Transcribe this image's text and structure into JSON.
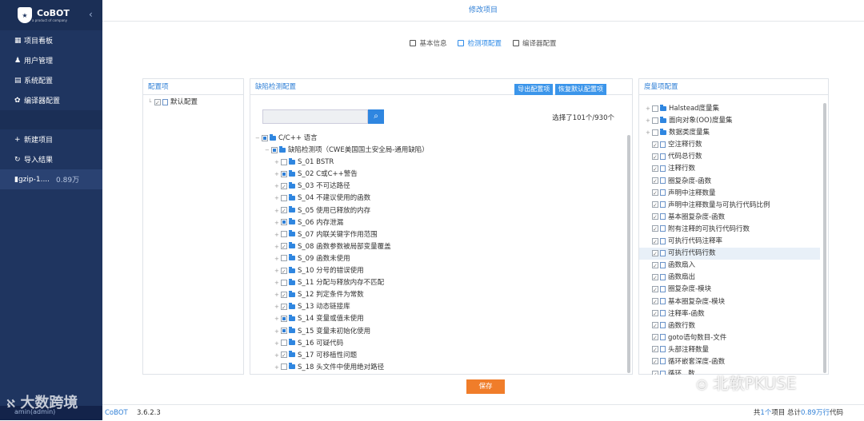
{
  "app": {
    "logo_text": "CoBOT",
    "logo_sub": "a product of company",
    "collapse": "‹"
  },
  "sidebar": {
    "nav": [
      {
        "label": "项目看板",
        "icon": "grid-icon"
      },
      {
        "label": "用户管理",
        "icon": "user-icon"
      },
      {
        "label": "系统配置",
        "icon": "document-icon"
      },
      {
        "label": "编译器配置",
        "icon": "gear-icon"
      }
    ],
    "actions": [
      {
        "label": "新建项目",
        "icon": "plus-icon"
      },
      {
        "label": "导入结果",
        "icon": "refresh-icon"
      }
    ],
    "project": {
      "name": "gzip-1....",
      "size": "0.89万"
    }
  },
  "header": {
    "title": "修改项目"
  },
  "tabs": [
    {
      "label": "基本信息",
      "active": false
    },
    {
      "label": "检测项配置",
      "active": true
    },
    {
      "label": "编译器配置",
      "active": false
    }
  ],
  "config_panel": {
    "title": "配置项",
    "root": "默认配置"
  },
  "defect_panel": {
    "title": "缺陷检测配置",
    "export_label": "导出配置项",
    "restore_label": "恢复默认配置项",
    "selected_text": "选择了101个/930个",
    "tree": [
      {
        "label": "C/C++ 语言",
        "level": 0,
        "state": "partial",
        "tog": "−"
      },
      {
        "label": "缺陷检测项（CWE美国国土安全局-通用缺陷）",
        "level": 1,
        "state": "partial",
        "tog": "−"
      },
      {
        "label": "S_01 BSTR",
        "level": 2,
        "state": "none",
        "tog": "+"
      },
      {
        "label": "S_02 C或C++警告",
        "level": 2,
        "state": "partial",
        "tog": "+"
      },
      {
        "label": "S_03 不可达路径",
        "level": 2,
        "state": "checked",
        "tog": "+"
      },
      {
        "label": "S_04 不建议使用的函数",
        "level": 2,
        "state": "none",
        "tog": "+"
      },
      {
        "label": "S_05 使用已释放的内存",
        "level": 2,
        "state": "checked",
        "tog": "+"
      },
      {
        "label": "S_06 内存泄漏",
        "level": 2,
        "state": "partial",
        "tog": "+"
      },
      {
        "label": "S_07 内联关键字作用范围",
        "level": 2,
        "state": "none",
        "tog": "+"
      },
      {
        "label": "S_08 函数参数被局部变量覆盖",
        "level": 2,
        "state": "checked",
        "tog": "+"
      },
      {
        "label": "S_09 函数未使用",
        "level": 2,
        "state": "none",
        "tog": "+"
      },
      {
        "label": "S_10 分号的错误使用",
        "level": 2,
        "state": "checked",
        "tog": "+"
      },
      {
        "label": "S_11 分配与释放内存不匹配",
        "level": 2,
        "state": "none",
        "tog": "+"
      },
      {
        "label": "S_12 判定条件为常数",
        "level": 2,
        "state": "checked",
        "tog": "+"
      },
      {
        "label": "S_13 动态链接库",
        "level": 2,
        "state": "checked",
        "tog": "+"
      },
      {
        "label": "S_14 变量或值未使用",
        "level": 2,
        "state": "partial",
        "tog": "+"
      },
      {
        "label": "S_15 变量未初始化使用",
        "level": 2,
        "state": "partial",
        "tog": "+"
      },
      {
        "label": "S_16 可疑代码",
        "level": 2,
        "state": "none",
        "tog": "+"
      },
      {
        "label": "S_17 可移植性问题",
        "level": 2,
        "state": "checked",
        "tog": "+"
      },
      {
        "label": "S_18 头文件中使用绝对路径",
        "level": 2,
        "state": "none",
        "tog": "+"
      }
    ]
  },
  "metric_panel": {
    "title": "度量项配置",
    "tree": [
      {
        "label": "Halstead度量集",
        "type": "folder",
        "state": "none",
        "tog": "+"
      },
      {
        "label": "面向对象(OO)度量集",
        "type": "folder",
        "state": "none",
        "tog": "+"
      },
      {
        "label": "数据类度量集",
        "type": "folder",
        "state": "none",
        "tog": "+"
      },
      {
        "label": "空注释行数",
        "type": "doc",
        "state": "checked"
      },
      {
        "label": "代码总行数",
        "type": "doc",
        "state": "checked"
      },
      {
        "label": "注释行数",
        "type": "doc",
        "state": "checked"
      },
      {
        "label": "圈复杂度-函数",
        "type": "doc",
        "state": "checked"
      },
      {
        "label": "声明中注释数量",
        "type": "doc",
        "state": "checked"
      },
      {
        "label": "声明中注释数量与可执行代码比例",
        "type": "doc",
        "state": "checked"
      },
      {
        "label": "基本圈复杂度-函数",
        "type": "doc",
        "state": "checked"
      },
      {
        "label": "附有注释的可执行代码行数",
        "type": "doc",
        "state": "checked"
      },
      {
        "label": "可执行代码注释率",
        "type": "doc",
        "state": "checked"
      },
      {
        "label": "可执行代码行数",
        "type": "doc",
        "state": "checked",
        "highlight": true
      },
      {
        "label": "函数扇入",
        "type": "doc",
        "state": "checked"
      },
      {
        "label": "函数扇出",
        "type": "doc",
        "state": "checked"
      },
      {
        "label": "圈复杂度-模块",
        "type": "doc",
        "state": "checked"
      },
      {
        "label": "基本圈复杂度-模块",
        "type": "doc",
        "state": "checked"
      },
      {
        "label": "注释率-函数",
        "type": "doc",
        "state": "checked"
      },
      {
        "label": "函数行数",
        "type": "doc",
        "state": "checked"
      },
      {
        "label": "goto语句数目-文件",
        "type": "doc",
        "state": "checked"
      },
      {
        "label": "头部注释数量",
        "type": "doc",
        "state": "checked"
      },
      {
        "label": "循环嵌套深度-函数",
        "type": "doc",
        "state": "checked"
      },
      {
        "label": "循环...数",
        "type": "doc",
        "state": "checked"
      }
    ]
  },
  "save_label": "保存",
  "footer": {
    "user": "amin(admin)",
    "brand": "CoBOT",
    "version": "3.6.2.3",
    "stats_pre": "共",
    "count": "1个",
    "stats_mid": "项目  总计",
    "lines": "0.89万行",
    "stats_post": "代码"
  },
  "watermarks": {
    "left": "大数跨境",
    "right": "北软PKUSE"
  }
}
